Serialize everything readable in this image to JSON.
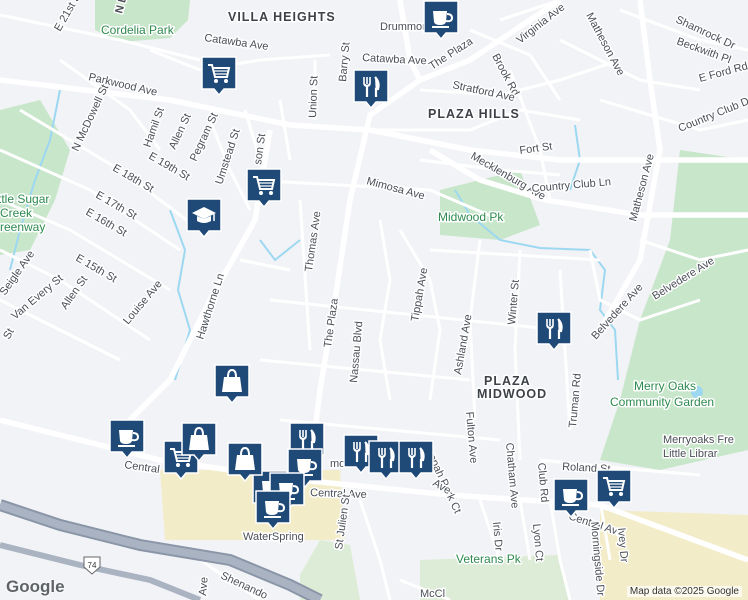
{
  "neighborhoods": [
    {
      "id": "villa",
      "text": "VILLA HEIGHTS"
    },
    {
      "id": "plaza_hills",
      "text": "PLAZA HILLS"
    },
    {
      "id": "plaza",
      "text": "PLAZA"
    },
    {
      "id": "midwood",
      "text": "MIDWOOD"
    }
  ],
  "parks": [
    {
      "id": "cordelia",
      "text": "Cordelia Park"
    },
    {
      "id": "midwood_pk",
      "text": "Midwood Pk"
    },
    {
      "id": "merry1",
      "text": "Merry Oaks"
    },
    {
      "id": "merry2",
      "text": "Community Garden"
    },
    {
      "id": "veterans",
      "text": "Veterans Pk"
    },
    {
      "id": "sugar1",
      "text": "ttle Sugar"
    },
    {
      "id": "sugar2",
      "text": "Creek"
    },
    {
      "id": "sugar3",
      "text": "reenway"
    }
  ],
  "places": [
    {
      "id": "merryoaks_lib1",
      "text": "Merryoaks Fre"
    },
    {
      "id": "merryoaks_lib2",
      "text": "Little Librar"
    },
    {
      "id": "waterspring",
      "text": "WaterSpring"
    }
  ],
  "streets": [
    {
      "id": "e21",
      "text": "E 21st St"
    },
    {
      "id": "nd",
      "text": "N D"
    },
    {
      "id": "catawba1",
      "text": "Catawba Ave"
    },
    {
      "id": "catawba2",
      "text": "Catawba Ave"
    },
    {
      "id": "drummond",
      "text": "Drummond"
    },
    {
      "id": "theplaza_n",
      "text": "The Plaza"
    },
    {
      "id": "brook",
      "text": "Brook Rd"
    },
    {
      "id": "virginia",
      "text": "Virginia Ave"
    },
    {
      "id": "matheson_n",
      "text": "Matheson Ave"
    },
    {
      "id": "shamrock",
      "text": "Shamrock Dr"
    },
    {
      "id": "beckwith",
      "text": "Beckwith Pl"
    },
    {
      "id": "eford",
      "text": "E Ford Rd"
    },
    {
      "id": "countryclubdr",
      "text": "Country Club Dr"
    },
    {
      "id": "parkwood",
      "text": "Parkwood Ave"
    },
    {
      "id": "mcdowell",
      "text": "N McDowell St"
    },
    {
      "id": "barry",
      "text": "Barry St"
    },
    {
      "id": "union",
      "text": "Union St"
    },
    {
      "id": "stratford",
      "text": "Stratford Ave"
    },
    {
      "id": "hamil",
      "text": "Hamil St"
    },
    {
      "id": "allen_n",
      "text": "Allen St"
    },
    {
      "id": "pegram",
      "text": "Pegram St"
    },
    {
      "id": "e19",
      "text": "E 19th St"
    },
    {
      "id": "umstead",
      "text": "Umstead St"
    },
    {
      "id": "jackson",
      "text": "son St"
    },
    {
      "id": "fort",
      "text": "Fort St"
    },
    {
      "id": "mecklenburg",
      "text": "Mecklenburg Ave"
    },
    {
      "id": "countryclubln",
      "text": "Country Club Ln"
    },
    {
      "id": "matheson_e",
      "text": "Matheson Ave"
    },
    {
      "id": "e18",
      "text": "E 18th St"
    },
    {
      "id": "e17",
      "text": "E 17th St"
    },
    {
      "id": "e16",
      "text": "E 16th St"
    },
    {
      "id": "e15",
      "text": "E 15th St"
    },
    {
      "id": "mimosa",
      "text": "Mimosa Ave"
    },
    {
      "id": "thomas",
      "text": "Thomas Ave"
    },
    {
      "id": "seigle",
      "text": "Seigle Ave"
    },
    {
      "id": "vanevery",
      "text": "Van Every St"
    },
    {
      "id": "allen_s",
      "text": "Allen St"
    },
    {
      "id": "louise",
      "text": "Louise Ave"
    },
    {
      "id": "hawthorne",
      "text": "Hawthorne Ln"
    },
    {
      "id": "theplaza_s",
      "text": "The Plaza"
    },
    {
      "id": "nassau",
      "text": "Nassau Blvd"
    },
    {
      "id": "tippah",
      "text": "Tippah Ave"
    },
    {
      "id": "winter",
      "text": "Winter St"
    },
    {
      "id": "belvedere",
      "text": "Belvedere Ave"
    },
    {
      "id": "belvedere2",
      "text": "Belvedere Ave"
    },
    {
      "id": "ashland",
      "text": "Ashland Ave"
    },
    {
      "id": "truman",
      "text": "Truman Rd"
    },
    {
      "id": "fulton",
      "text": "Fulton Ave"
    },
    {
      "id": "chatham",
      "text": "Chatham Ave"
    },
    {
      "id": "roland",
      "text": "Roland St"
    },
    {
      "id": "clubrd",
      "text": "Club Rd"
    },
    {
      "id": "central_w",
      "text": "Central"
    },
    {
      "id": "central_m",
      "text": "Central Ave"
    },
    {
      "id": "central_e",
      "text": "Central Ave"
    },
    {
      "id": "tippahpark",
      "text": "ppah Park Ct"
    },
    {
      "id": "ave_frag",
      "text": "Ave"
    },
    {
      "id": "stjulien",
      "text": "St Julien St"
    },
    {
      "id": "iris",
      "text": "Iris Dr"
    },
    {
      "id": "lyon",
      "text": "Lyon Ct"
    },
    {
      "id": "morningside",
      "text": "Morningside Dr"
    },
    {
      "id": "ivey",
      "text": "Ivey Dr"
    },
    {
      "id": "shenandoah",
      "text": "Shenando"
    },
    {
      "id": "ave_sw",
      "text": "Ave"
    },
    {
      "id": "mccl",
      "text": "McCl"
    },
    {
      "id": "mo_frag",
      "text": "mo"
    },
    {
      "id": "st_sw",
      "text": "St"
    }
  ],
  "highway_shield": "74",
  "markers": [
    {
      "id": "cafe1",
      "icon": "coffee-cup-icon"
    },
    {
      "id": "rest1",
      "icon": "fork-knife-icon"
    },
    {
      "id": "shop1",
      "icon": "shopping-cart-icon"
    },
    {
      "id": "shop2",
      "icon": "shopping-cart-icon"
    },
    {
      "id": "school1",
      "icon": "graduation-cap-icon"
    },
    {
      "id": "rest2",
      "icon": "fork-knife-icon"
    },
    {
      "id": "bag1",
      "icon": "shopping-bag-icon"
    },
    {
      "id": "cafe2",
      "icon": "coffee-cup-icon"
    },
    {
      "id": "shop3",
      "icon": "shopping-cart-icon"
    },
    {
      "id": "bag2",
      "icon": "shopping-bag-icon"
    },
    {
      "id": "rest3",
      "icon": "fork-knife-icon"
    },
    {
      "id": "rest4",
      "icon": "fork-knife-icon"
    },
    {
      "id": "rest5",
      "icon": "fork-knife-icon"
    },
    {
      "id": "rest6",
      "icon": "fork-knife-icon"
    },
    {
      "id": "cafe3",
      "icon": "coffee-cup-icon"
    },
    {
      "id": "cafe4",
      "icon": "coffee-cup-icon"
    },
    {
      "id": "cafe5",
      "icon": "coffee-cup-icon"
    },
    {
      "id": "cafe6",
      "icon": "coffee-cup-icon"
    },
    {
      "id": "shop4",
      "icon": "shopping-cart-icon"
    },
    {
      "id": "cafe7",
      "icon": "coffee-cup-icon"
    },
    {
      "id": "bag3",
      "icon": "shopping-bag-icon"
    },
    {
      "id": "rest7",
      "icon": "fork-knife-icon"
    }
  ],
  "colors": {
    "marker": "#1f4a78",
    "park": "#c8e6c9",
    "water": "#9dd8f2",
    "highway": "#8a96a8",
    "road": "#ffffff"
  },
  "attribution": "Map data ©2025 Google",
  "logo": "Google"
}
